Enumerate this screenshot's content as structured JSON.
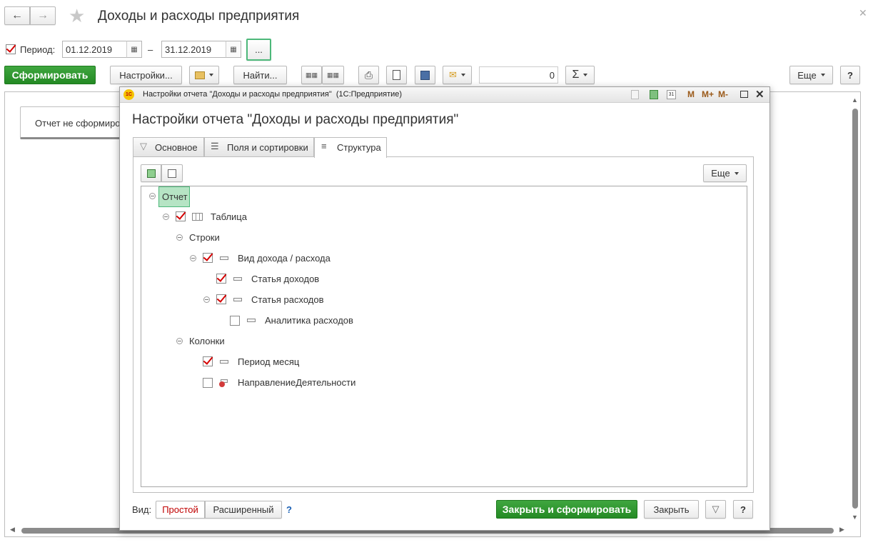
{
  "main": {
    "title": "Доходы и расходы предприятия",
    "period_label": "Период:",
    "date_from": "01.12.2019",
    "date_to": "31.12.2019",
    "dash": "–",
    "more_dots": "...",
    "form_button": "Сформировать",
    "settings_button": "Настройки...",
    "find_button": "Найти...",
    "sum_value": "0",
    "more_button": "Еще",
    "help_button": "?",
    "report_status": "Отчет не сформирован"
  },
  "dialog": {
    "window_title": "Настройки отчета \"Доходы и расходы предприятия\"  (1С:Предприятие)",
    "heading": "Настройки отчета \"Доходы и расходы предприятия\"",
    "toolbar_m": "M",
    "toolbar_mplus": "M+",
    "toolbar_mminus": "M-",
    "tabs": [
      {
        "label": "Основное"
      },
      {
        "label": "Поля и сортировки"
      },
      {
        "label": "Структура"
      }
    ],
    "more_button": "Еще",
    "tree": {
      "root": "Отчет",
      "table": "Таблица",
      "rows": "Строки",
      "group": "Вид дохода / расхода",
      "income": "Статья доходов",
      "expense": "Статья расходов",
      "analytics": "Аналитика расходов",
      "columns": "Колонки",
      "period": "Период месяц",
      "direction": "НаправлениеДеятельности"
    },
    "view_label": "Вид:",
    "view_simple": "Простой",
    "view_extended": "Расширенный",
    "view_help": "?",
    "close_and_form": "Закрыть и сформировать",
    "close": "Закрыть",
    "help": "?"
  }
}
